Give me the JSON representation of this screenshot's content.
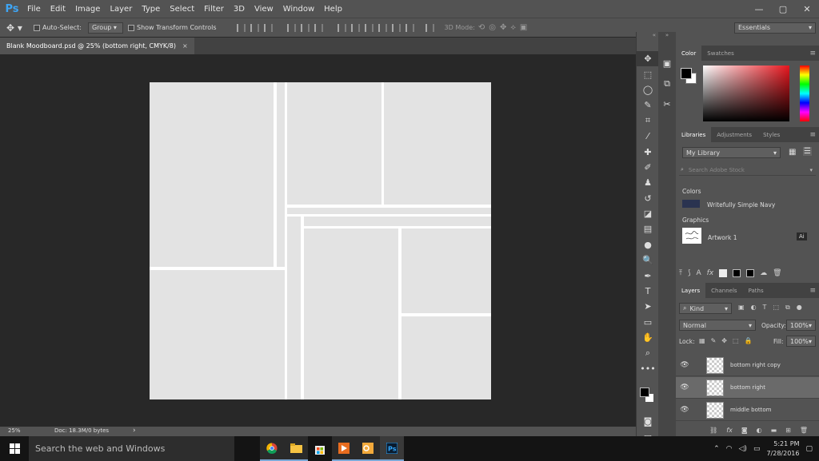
{
  "app": {
    "logo": "Ps"
  },
  "menu": [
    "File",
    "Edit",
    "Image",
    "Layer",
    "Type",
    "Select",
    "Filter",
    "3D",
    "View",
    "Window",
    "Help"
  ],
  "window_controls": {
    "minimize": "—",
    "maximize": "▢",
    "close": "✕"
  },
  "options": {
    "auto_select_label": "Auto-Select:",
    "auto_select_value": "Group",
    "transform_label": "Show Transform Controls",
    "mode_3d": "3D Mode:",
    "workspace": "Essentials"
  },
  "document": {
    "tab_title": "Blank Moodboard.psd @ 25% (bottom right, CMYK/8)",
    "tab_close": "×"
  },
  "status": {
    "zoom": "25%",
    "doc_size": "Doc: 18.3M/0 bytes",
    "arrow": "›"
  },
  "toolbox": {
    "tools": [
      {
        "name": "move-tool-icon",
        "glyph": "✥"
      },
      {
        "name": "marquee-tool-icon",
        "glyph": "⬚"
      },
      {
        "name": "lasso-tool-icon",
        "glyph": "◯"
      },
      {
        "name": "quick-select-tool-icon",
        "glyph": "✎"
      },
      {
        "name": "crop-tool-icon",
        "glyph": "⌗"
      },
      {
        "name": "eyedropper-tool-icon",
        "glyph": "⁄"
      },
      {
        "name": "healing-brush-tool-icon",
        "glyph": "✚"
      },
      {
        "name": "brush-tool-icon",
        "glyph": "✐"
      },
      {
        "name": "clone-stamp-tool-icon",
        "glyph": "♟"
      },
      {
        "name": "history-brush-tool-icon",
        "glyph": "↺"
      },
      {
        "name": "eraser-tool-icon",
        "glyph": "◪"
      },
      {
        "name": "gradient-tool-icon",
        "glyph": "▤"
      },
      {
        "name": "blur-tool-icon",
        "glyph": "●"
      },
      {
        "name": "dodge-tool-icon",
        "glyph": "🔍"
      },
      {
        "name": "pen-tool-icon",
        "glyph": "✒"
      },
      {
        "name": "type-tool-icon",
        "glyph": "T"
      },
      {
        "name": "path-select-tool-icon",
        "glyph": "➤"
      },
      {
        "name": "rectangle-tool-icon",
        "glyph": "▭"
      },
      {
        "name": "hand-tool-icon",
        "glyph": "✋"
      },
      {
        "name": "zoom-tool-icon",
        "glyph": "⌕"
      },
      {
        "name": "more-tools-icon",
        "glyph": "•••"
      }
    ]
  },
  "color_panel": {
    "tabs": [
      "Color",
      "Swatches"
    ],
    "active": "Color"
  },
  "libraries_panel": {
    "tabs": [
      "Libraries",
      "Adjustments",
      "Styles"
    ],
    "library": "My Library",
    "search_placeholder": "Search Adobe Stock",
    "colors_heading": "Colors",
    "color_item": "Writefully Simple Navy",
    "color_swatch": "#2a3350",
    "graphics_heading": "Graphics",
    "graphic_item": "Artwork 1",
    "graphic_badge": "Ai"
  },
  "layers_panel": {
    "tabs": [
      "Layers",
      "Channels",
      "Paths"
    ],
    "filter": "Kind",
    "blend_mode": "Normal",
    "opacity_label": "Opacity:",
    "opacity": "100%",
    "lock_label": "Lock:",
    "fill_label": "Fill:",
    "fill": "100%",
    "layers": [
      {
        "name": "bottom right copy",
        "selected": false
      },
      {
        "name": "bottom right",
        "selected": true
      },
      {
        "name": "middle bottom",
        "selected": false
      }
    ],
    "footer_icons": [
      "link",
      "fx",
      "mask",
      "adjustment",
      "group",
      "new",
      "trash"
    ]
  },
  "taskbar": {
    "search_placeholder": "Search the web and Windows",
    "time": "5:21 PM",
    "date": "7/28/2016",
    "apps": [
      "chrome",
      "explorer",
      "store",
      "media",
      "outlook",
      "photoshop"
    ]
  }
}
